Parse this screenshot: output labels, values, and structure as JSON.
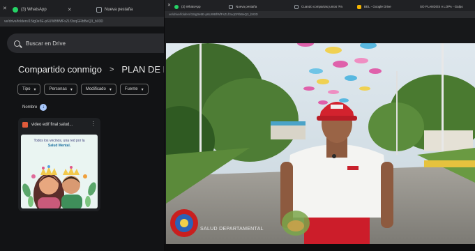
{
  "left_window": {
    "tabs": [
      {
        "label": "(3) WhatsApp",
        "icon": "whatsapp-icon",
        "color": "#25d366"
      },
      {
        "label": "Nueva pestaña",
        "icon": "page-icon",
        "color": "#9aa0a6"
      }
    ],
    "address": "ve/drive/folders/15tg0e5E-p6UWBfWfFsZLf3oqGRbBeQ3_b03D",
    "search_placeholder": "Buscar en Drive",
    "breadcrumb": {
      "root": "Compartido conmigo",
      "separator": ">",
      "current": "PLAN DE MEDI"
    },
    "filters": [
      "Tipo",
      "Personas",
      "Modificado",
      "Fuente"
    ],
    "sort_label": "Nombre",
    "file": {
      "name": "video edif final salud...",
      "thumbnail_text": "Todos los vecinos, una red por la",
      "thumbnail_strong": "Salud Mental."
    }
  },
  "right_window": {
    "tabs": [
      {
        "label": "(3) WhatsApp",
        "icon": "whatsapp-icon",
        "color": "#25d366"
      },
      {
        "label": "Nueva pestaña",
        "icon": "page-icon",
        "color": "#9aa0a6"
      },
      {
        "label": "Cuando compartas juntos 'Pa",
        "icon": "page-icon",
        "color": "#9aa0a6"
      },
      {
        "label": "BEL - Google Drive",
        "icon": "drive-icon",
        "color": "#f4b400"
      },
      {
        "label": "SO PLANDOS A LOPA - Galpo",
        "icon": "page-icon",
        "color": "#9aa0a6"
      }
    ],
    "address": "ve/drive/folders/15tg0e5E-p6UWBfWfFsZLf3oqGRbBeQ3_b03D",
    "video": {
      "caption": "SALUD DEPARTAMENTAL"
    }
  }
}
